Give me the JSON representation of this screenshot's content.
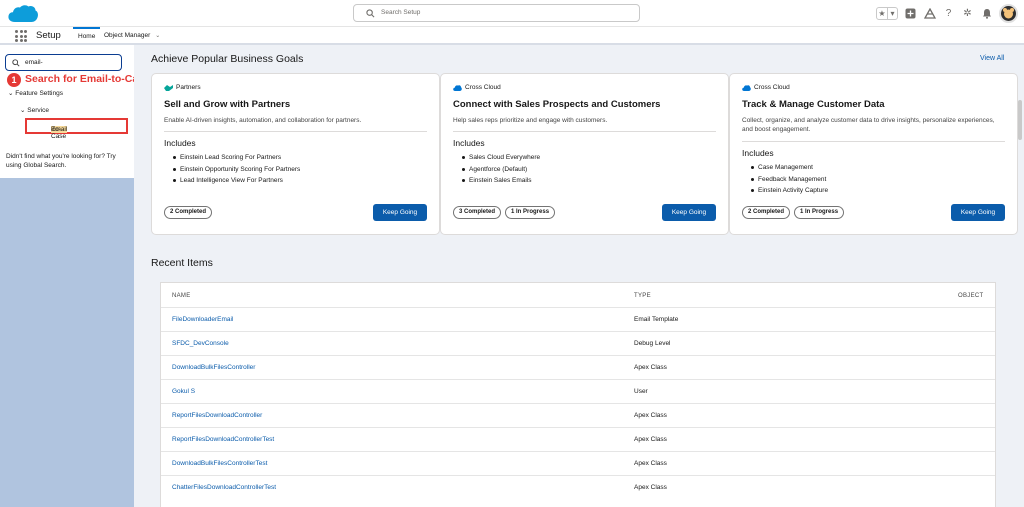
{
  "header": {
    "search_placeholder": "Search Setup",
    "icons": [
      "favorites-star-icon",
      "favorites-list-icon",
      "add-icon",
      "trailhead-icon",
      "help-icon",
      "gear-icon",
      "bell-icon",
      "avatar"
    ]
  },
  "nav": {
    "app_name": "Setup",
    "tabs": [
      {
        "label": "Home",
        "active": true
      },
      {
        "label": "Object Manager",
        "active": false
      }
    ]
  },
  "sidebar": {
    "quickfind_value": "email-",
    "annotation": {
      "step": "1",
      "text": "Search for Email-to-Case"
    },
    "tree": {
      "feature_settings": "Feature Settings",
      "service": "Service",
      "email_to_case_highlight": "Email",
      "email_to_case_rest": "-to-Case"
    },
    "not_found_text": "Didn't find what you're looking for? Try using Global Search."
  },
  "main": {
    "goals_title": "Achieve Popular Business Goals",
    "view_all": "View All",
    "cards": [
      {
        "tag": "Partners",
        "title": "Sell and Grow with Partners",
        "desc": "Enable AI-driven insights, automation, and collaboration for partners.",
        "includes_label": "Includes",
        "items": [
          "Einstein Lead Scoring For Partners",
          "Einstein Opportunity Scoring For Partners",
          "Lead Intelligence View For Partners"
        ],
        "pills": [
          "2 Completed"
        ],
        "button": "Keep Going"
      },
      {
        "tag": "Cross Cloud",
        "title": "Connect with Sales Prospects and Customers",
        "desc": "Help sales reps prioritize and engage with customers.",
        "includes_label": "Includes",
        "items": [
          "Sales Cloud Everywhere",
          "Agentforce (Default)",
          "Einstein Sales Emails"
        ],
        "pills": [
          "3 Completed",
          "1 In Progress"
        ],
        "button": "Keep Going"
      },
      {
        "tag": "Cross Cloud",
        "title": "Track & Manage Customer Data",
        "desc": "Collect, organize, and analyze customer data to drive insights, personalize experiences, and boost engagement.",
        "includes_label": "Includes",
        "items": [
          "Case Management",
          "Feedback Management",
          "Einstein Activity Capture"
        ],
        "pills": [
          "2 Completed",
          "1 In Progress"
        ],
        "button": "Keep Going"
      }
    ],
    "recent_title": "Recent Items",
    "columns": {
      "name": "NAME",
      "type": "TYPE",
      "object": "OBJECT"
    },
    "rows": [
      {
        "name": "FileDownloaderEmail",
        "type": "Email Template"
      },
      {
        "name": "SFDC_DevConsole",
        "type": "Debug Level"
      },
      {
        "name": "DownloadBulkFilesController",
        "type": "Apex Class"
      },
      {
        "name": "Gokul S",
        "type": "User"
      },
      {
        "name": "ReportFilesDownloadController",
        "type": "Apex Class"
      },
      {
        "name": "ReportFilesDownloadControllerTest",
        "type": "Apex Class"
      },
      {
        "name": "DownloadBulkFilesControllerTest",
        "type": "Apex Class"
      },
      {
        "name": "ChatterFilesDownloadControllerTest",
        "type": "Apex Class"
      }
    ]
  },
  "colors": {
    "brand": "#0b5cab",
    "annotation": "#e53935",
    "sidebar_bg": "#b0c4df",
    "main_bg": "#eef1f6"
  }
}
